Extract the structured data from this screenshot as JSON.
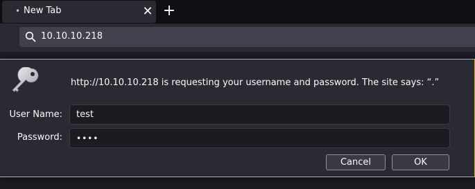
{
  "tab": {
    "dot": "•",
    "title": "New Tab",
    "close_label": "✕",
    "new_tab_label": "+"
  },
  "urlbar": {
    "value": "10.10.10.218"
  },
  "dialog": {
    "message": "http://10.10.10.218 is requesting your username and password. The site says: “.”",
    "username_label": "User Name:",
    "username_value": "test",
    "password_label": "Password:",
    "password_value": "••••",
    "cancel_label": "Cancel",
    "ok_label": "OK"
  },
  "colors": {
    "accent": "#e0aa3a",
    "bg": "#2b2a33",
    "field_bg": "#1c1b22"
  }
}
